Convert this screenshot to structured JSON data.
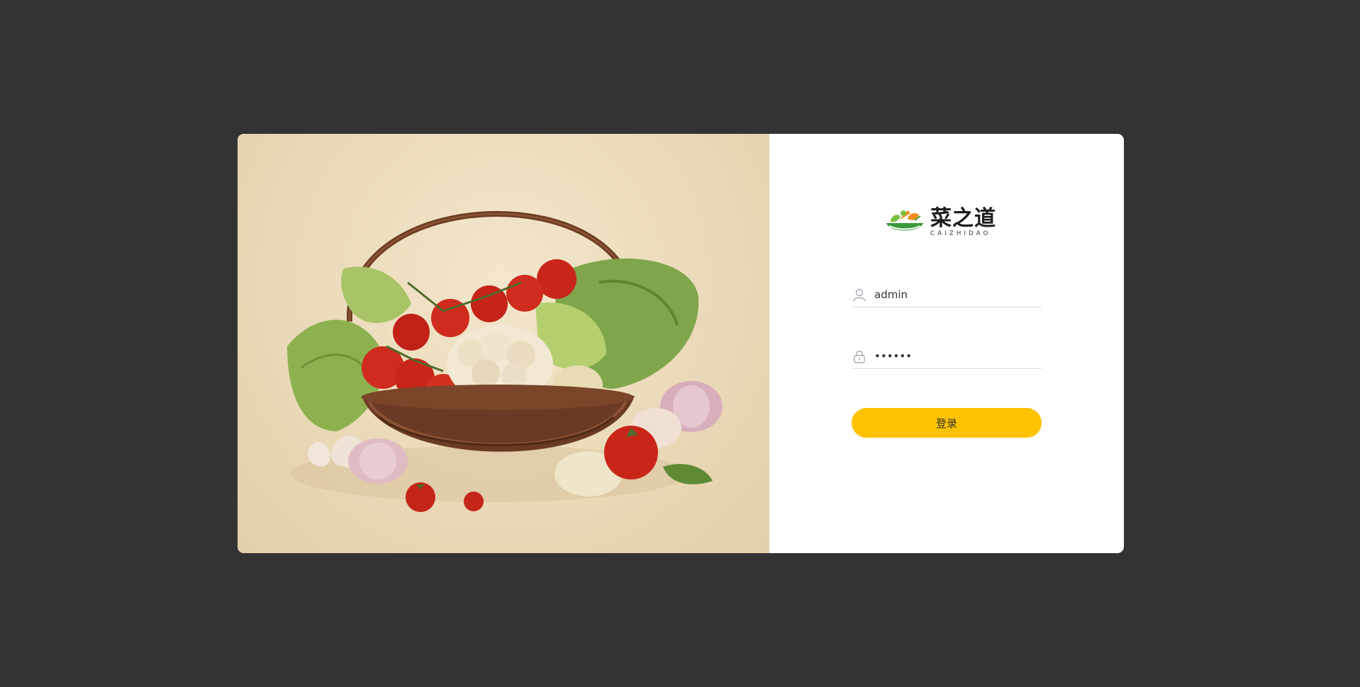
{
  "brand": {
    "name_cn": "菜之道",
    "name_en": "CAIZHIDAO"
  },
  "hero": {
    "icon": "vegetable-basket-illustration"
  },
  "form": {
    "username": {
      "value": "admin",
      "icon": "user-icon"
    },
    "password": {
      "value": "123456",
      "icon": "lock-icon"
    },
    "submit_label": "登录"
  },
  "colors": {
    "page_background": "#333333",
    "card_background": "#ffffff",
    "button": "#ffc200",
    "logo_green": "#3a9a3a",
    "logo_orange": "#f28c1e"
  }
}
